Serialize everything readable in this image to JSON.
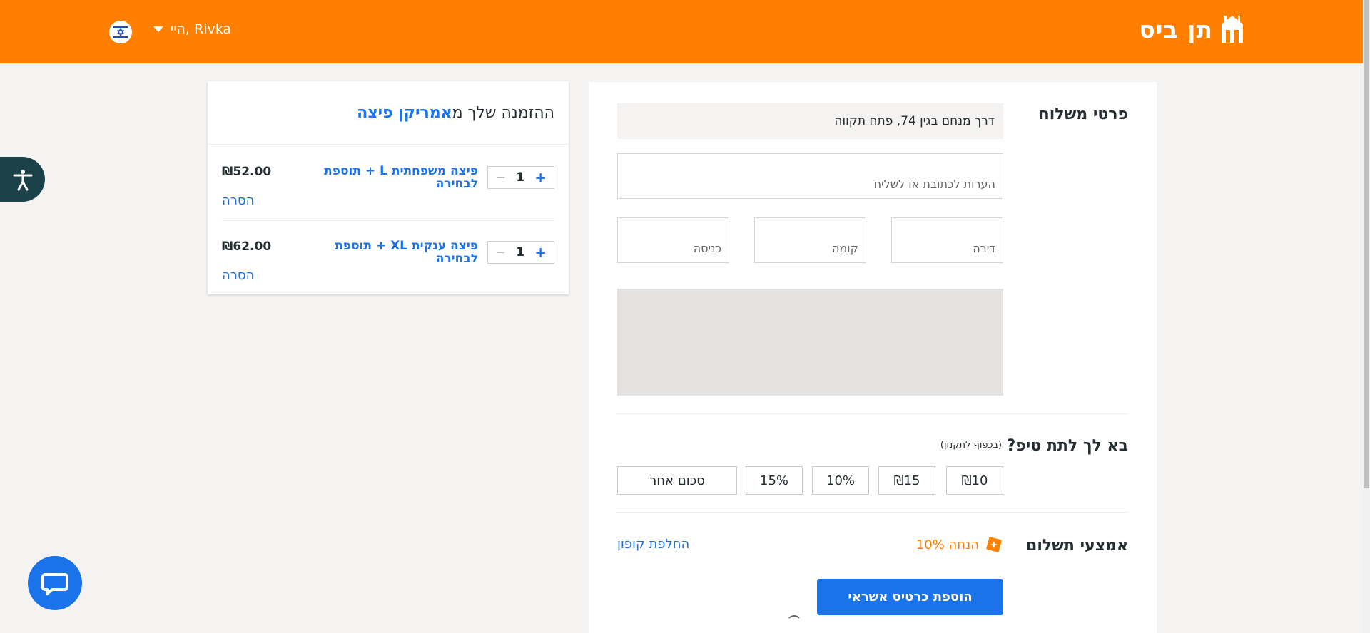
{
  "header": {
    "logo_text": "תן ביס",
    "greeting": "היי, Rivka",
    "brand_color": "#ff8000"
  },
  "order": {
    "title_prefix": "ההזמנה שלך מ",
    "restaurant": "אמריקן פיצה",
    "items": [
      {
        "name": "פיצה משפחתית L + תוספת לבחירה",
        "qty": "1",
        "price": "₪52.00",
        "remove": "הסרה"
      },
      {
        "name": "פיצה ענקית XL + תוספת לבחירה",
        "qty": "1",
        "price": "₪62.00",
        "remove": "הסרה"
      }
    ]
  },
  "delivery": {
    "title": "פרטי משלוח",
    "address": "דרך מנחם בגין 74, פתח תקווה",
    "notes_placeholder": "הערות לכתובת או לשליח",
    "apartment_placeholder": "דירה",
    "floor_placeholder": "קומה",
    "entrance_placeholder": "כניסה"
  },
  "tip": {
    "title": "בא לך לתת טיפ?",
    "note": "(בכפוף לתקנון)",
    "options": [
      "₪10",
      "₪15",
      "10%",
      "15%",
      "סכום אחר"
    ]
  },
  "payment": {
    "title": "אמצעי תשלום",
    "discount": "הנחה 10%",
    "change_coupon": "החלפת קופון",
    "add_card": "הוספת כרטיס אשראי"
  },
  "colors": {
    "accent": "#1a73e8",
    "orange": "#ff8000"
  }
}
